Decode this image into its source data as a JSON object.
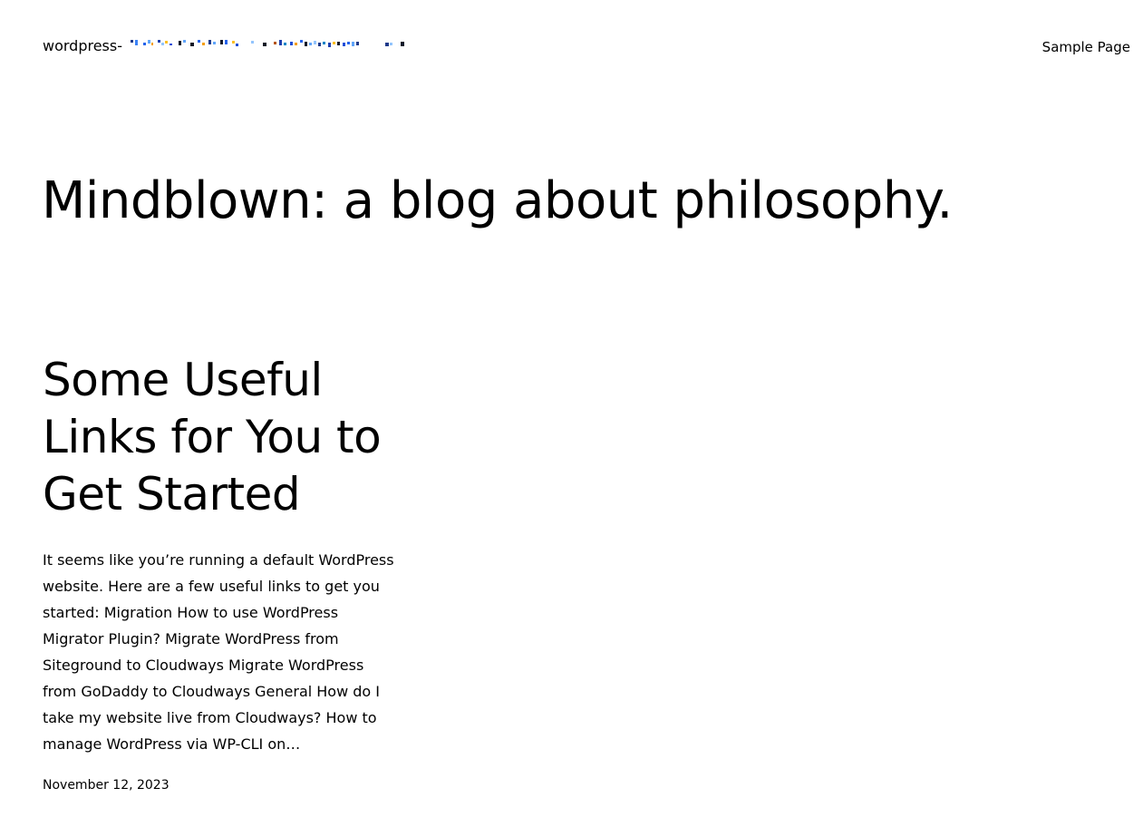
{
  "header": {
    "site_title_prefix": "wordpress-",
    "nav": {
      "sample_page": "Sample Page"
    }
  },
  "main": {
    "heading": "Mindblown: a blog about philosophy."
  },
  "posts": [
    {
      "title": "Some Useful Links for You to Get Started",
      "excerpt": "It seems like you’re running a default WordPress website. Here are a few useful links to get you started: Migration How to use WordPress Migrator Plugin? Migrate WordPress from Siteground to Cloudways Migrate WordPress from GoDaddy to Cloudways General How do I take my website live from Cloudways? How to manage WordPress via WP-CLI on…",
      "date": "November 12, 2023"
    }
  ]
}
